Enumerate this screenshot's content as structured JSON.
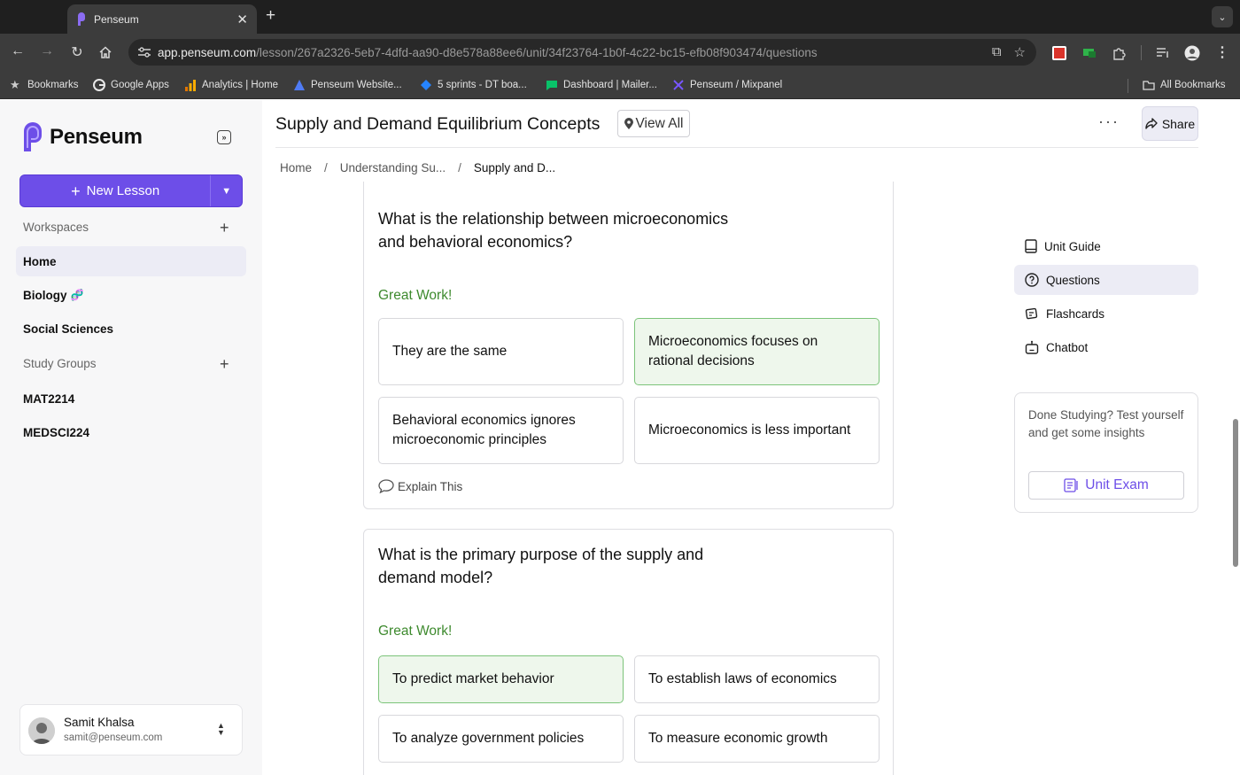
{
  "browser": {
    "tab_title": "Penseum",
    "url_host": "app.penseum.com",
    "url_path": "/lesson/267a2326-5eb7-4dfd-aa90-d8e578a88ee6/unit/34f23764-1b0f-4c22-bc15-efb08f903474/questions",
    "bookmarks": [
      {
        "label": "Bookmarks",
        "icon": "star-icon"
      },
      {
        "label": "Google Apps",
        "icon": "google-icon"
      },
      {
        "label": "Analytics | Home",
        "icon": "analytics-icon"
      },
      {
        "label": "Penseum Website...",
        "icon": "triangle-icon"
      },
      {
        "label": "5 sprints - DT boa...",
        "icon": "jira-icon"
      },
      {
        "label": "Dashboard | Mailer...",
        "icon": "mailer-icon"
      },
      {
        "label": "Penseum / Mixpanel",
        "icon": "mixpanel-icon"
      }
    ],
    "all_bookmarks": "All Bookmarks"
  },
  "sidebar": {
    "logo_text": "Penseum",
    "new_lesson": "New Lesson",
    "workspaces_label": "Workspaces",
    "items": [
      {
        "label": "Home"
      },
      {
        "label": "Biology"
      },
      {
        "label": "Social Sciences"
      }
    ],
    "study_groups_label": "Study Groups",
    "groups": [
      {
        "label": "MAT2214"
      },
      {
        "label": "MEDSCI224"
      }
    ],
    "user": {
      "name": "Samit Khalsa",
      "email": "samit@penseum.com"
    }
  },
  "header": {
    "title": "Supply and Demand Equilibrium Concepts",
    "view_all": "View All",
    "share": "Share",
    "breadcrumb": [
      "Home",
      "Understanding Su...",
      "Supply and D..."
    ]
  },
  "questions": [
    {
      "text": "What is the relationship between microeconomics and behavioral economics?",
      "feedback": "Great Work!",
      "options": [
        "They are the same",
        "Microeconomics focuses on rational decisions",
        "Behavioral economics ignores microeconomic principles",
        "Microeconomics is less important"
      ],
      "correct_index": 1,
      "explain": "Explain This"
    },
    {
      "text": "What is the primary purpose of the supply and demand model?",
      "feedback": "Great Work!",
      "options": [
        "To predict market behavior",
        "To establish laws of economics",
        "To analyze government policies",
        "To measure economic growth"
      ],
      "correct_index": 0
    }
  ],
  "right_nav": {
    "items": [
      "Unit Guide",
      "Questions",
      "Flashcards",
      "Chatbot"
    ],
    "active": "Questions",
    "exam_prompt": "Done Studying? Test yourself and get some insights",
    "exam_button": "Unit Exam"
  },
  "colors": {
    "accent": "#6d4ee8",
    "success": "#3e8a2e",
    "correct_bg": "#eef7ec",
    "correct_border": "#7cc47a"
  }
}
